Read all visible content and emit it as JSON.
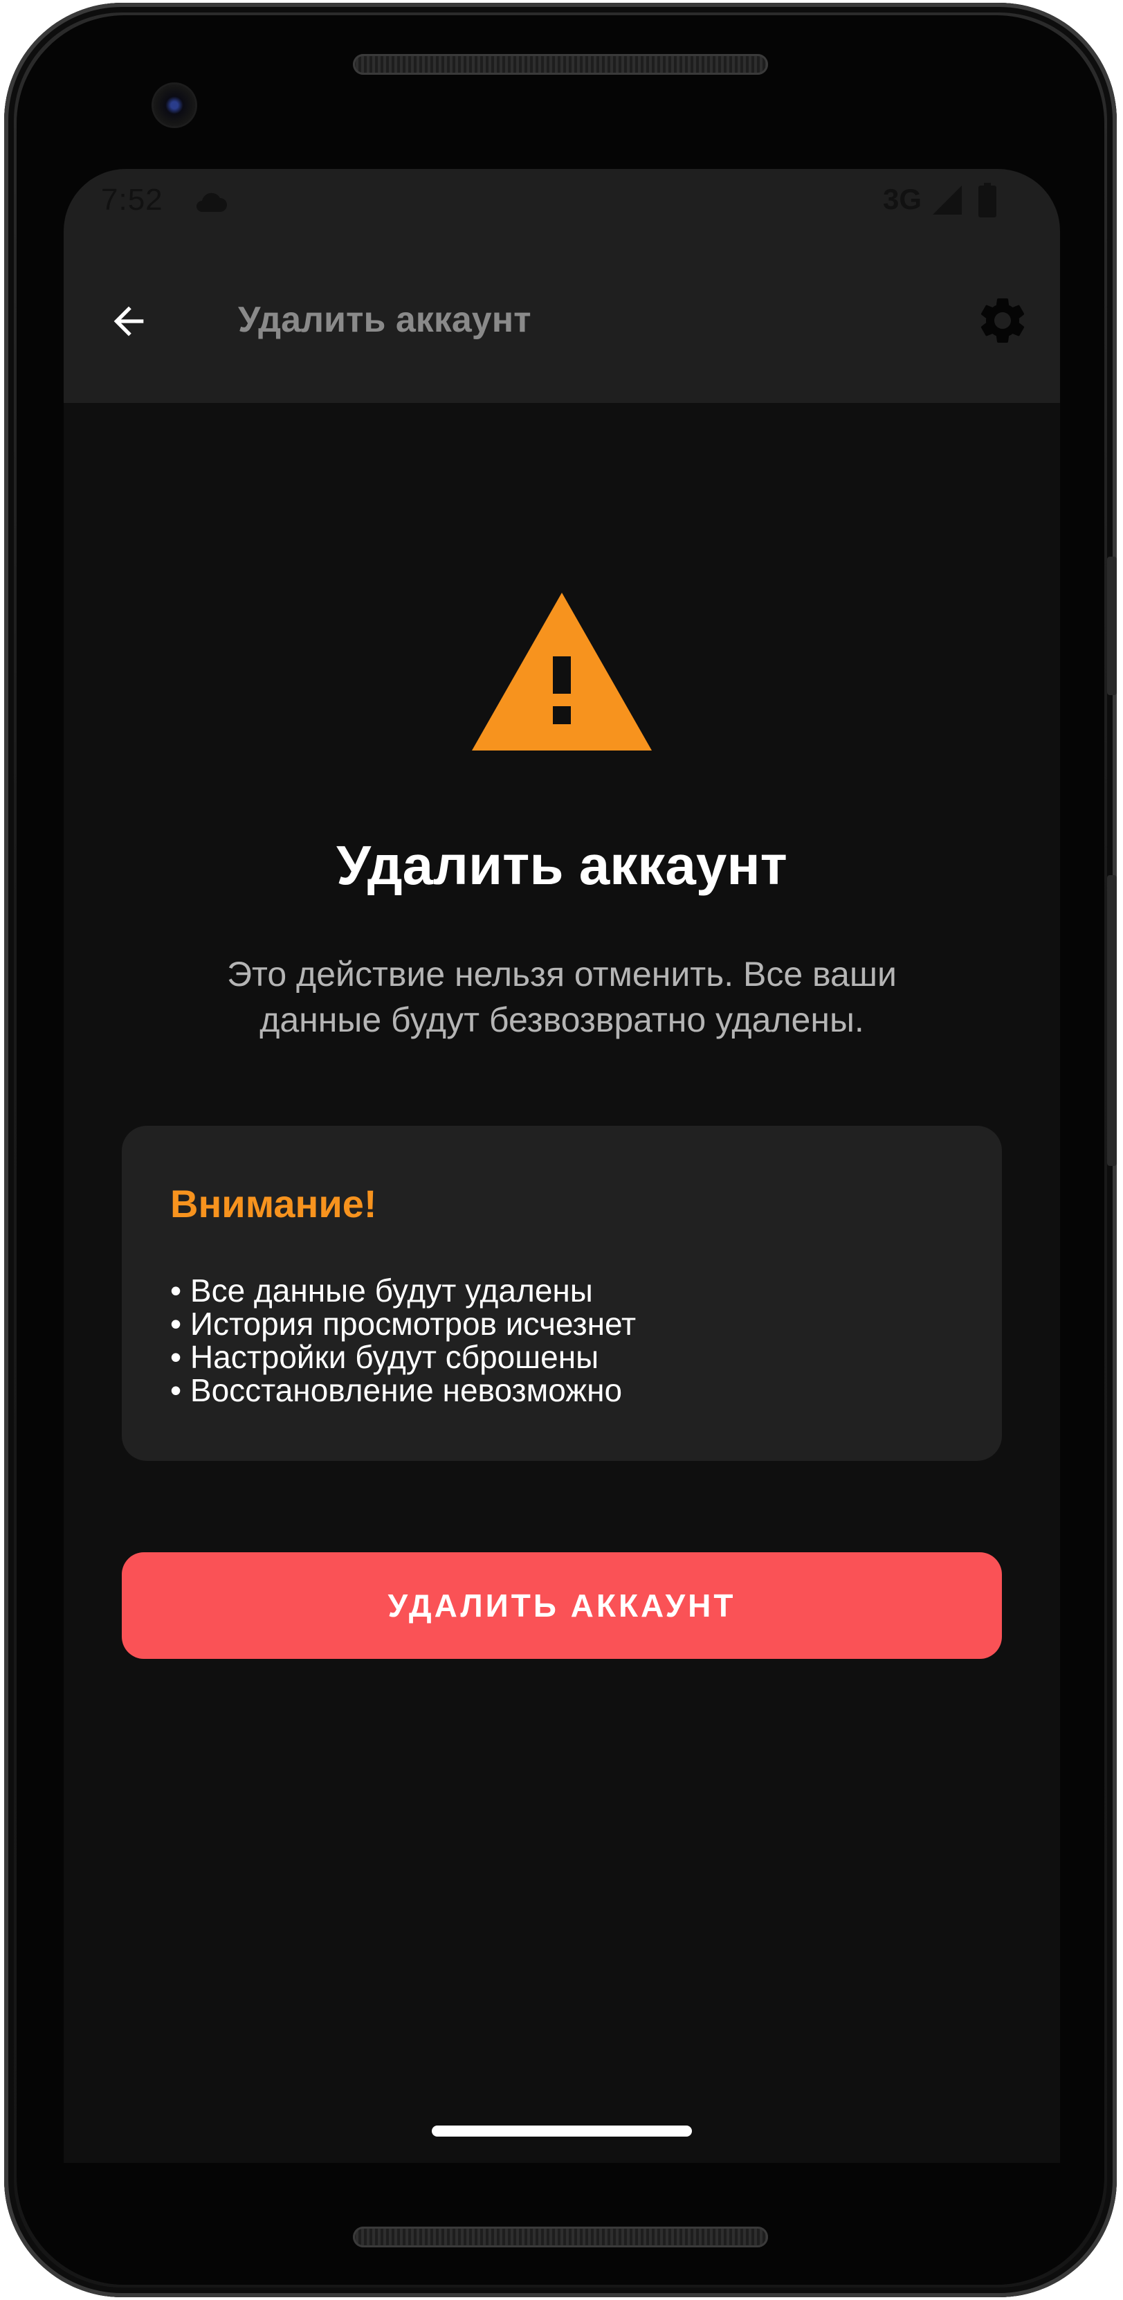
{
  "status_bar": {
    "time": "7:52",
    "network": "3G",
    "icons": [
      "cloud-icon",
      "signal-icon",
      "battery-icon"
    ]
  },
  "app_bar": {
    "title": "Удалить аккаунт",
    "back_icon": "arrow-back-icon",
    "settings_icon": "gear-icon"
  },
  "main": {
    "warning_icon": "warning-triangle-icon",
    "title": "Удалить аккаунт",
    "description_line1": "Это действие нельзя отменить. Все ваши",
    "description_line2": "данные будут безвозвратно удалены."
  },
  "attention": {
    "title": "Внимание!",
    "items": [
      "• Все данные будут удалены",
      "• История просмотров исчезнет",
      "• Настройки будут сброшены",
      "• Восстановление невозможно"
    ]
  },
  "actions": {
    "delete_label": "УДАЛИТЬ АККАУНТ"
  },
  "colors": {
    "background": "#0f0f0f",
    "app_bar": "#1f1f1f",
    "accent_orange": "#f7931e",
    "danger_red": "#fa5256",
    "card": "#212121"
  }
}
